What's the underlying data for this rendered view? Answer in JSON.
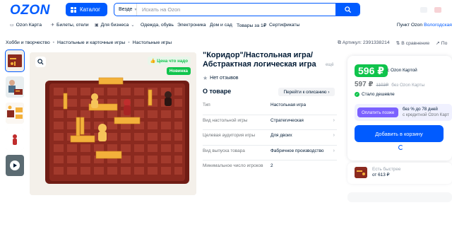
{
  "header": {
    "logo": "OZON",
    "catalog_label": "Каталог",
    "search_scope": "Везде",
    "search_placeholder": "Искать на Ozon"
  },
  "nav": {
    "items": [
      {
        "label": "Ozon Карта",
        "icon": "card-icon"
      },
      {
        "label": "Билеты, отели",
        "icon": "plane-icon"
      },
      {
        "label": "Для бизнеса",
        "icon": "briefcase-icon"
      },
      {
        "label": "Одежда, обувь"
      },
      {
        "label": "Электроника"
      },
      {
        "label": "Дом и сад"
      },
      {
        "label": "Товары за 1₽"
      },
      {
        "label": "Сертификаты"
      }
    ],
    "pickup_label": "Пункт Ozon",
    "city": "Вологодская"
  },
  "breadcrumbs": [
    "Хобби и творчество",
    "Настольные и карточные игры",
    "Настольные игры"
  ],
  "sku": "Артикул: 2391338214",
  "compare_label": "В сравнение",
  "share_label": "По",
  "badges": {
    "good_price": "Цена что надо",
    "new": "Новинка"
  },
  "product": {
    "title": "\"Коридор\"/Настольная игра/ Абстрактная логическая игра",
    "title_more": "ещё",
    "reviews": "Нет отзывов"
  },
  "about": {
    "heading": "О товаре",
    "to_description": "Перейти к описанию",
    "specs": [
      {
        "key": "Тип",
        "value": "Настольная игра"
      },
      {
        "key": "Вид настольной игры",
        "value": "Стратегическая"
      },
      {
        "key": "Целевая аудитория игры",
        "value": "Для двоих"
      },
      {
        "key": "Вид выпуска товара",
        "value": "Фабричное производство"
      },
      {
        "key": "Минимальное число игроков",
        "value": "2"
      }
    ]
  },
  "price": {
    "card_price": "596 ₽",
    "card_label": "c Ozon Картой",
    "regular": "597 ₽",
    "old": "1103₽",
    "without_card": "без Ozon Карты",
    "cheaper": "Стало дешевле",
    "pay_later_button": "Оплатить позже",
    "pay_later_line1": "без % до 78 дней",
    "pay_later_line2": "с кредитной Ozon Карт",
    "add_to_cart": "Добавить в корзину"
  },
  "faster": {
    "line1": "Есть быстрее",
    "line2": "от 613 ₽"
  },
  "colors": {
    "brand": "#005bff",
    "green": "#10c44c",
    "purple": "#7b61ff",
    "board": "#8b2a1f",
    "wall": "#f3b13b"
  }
}
